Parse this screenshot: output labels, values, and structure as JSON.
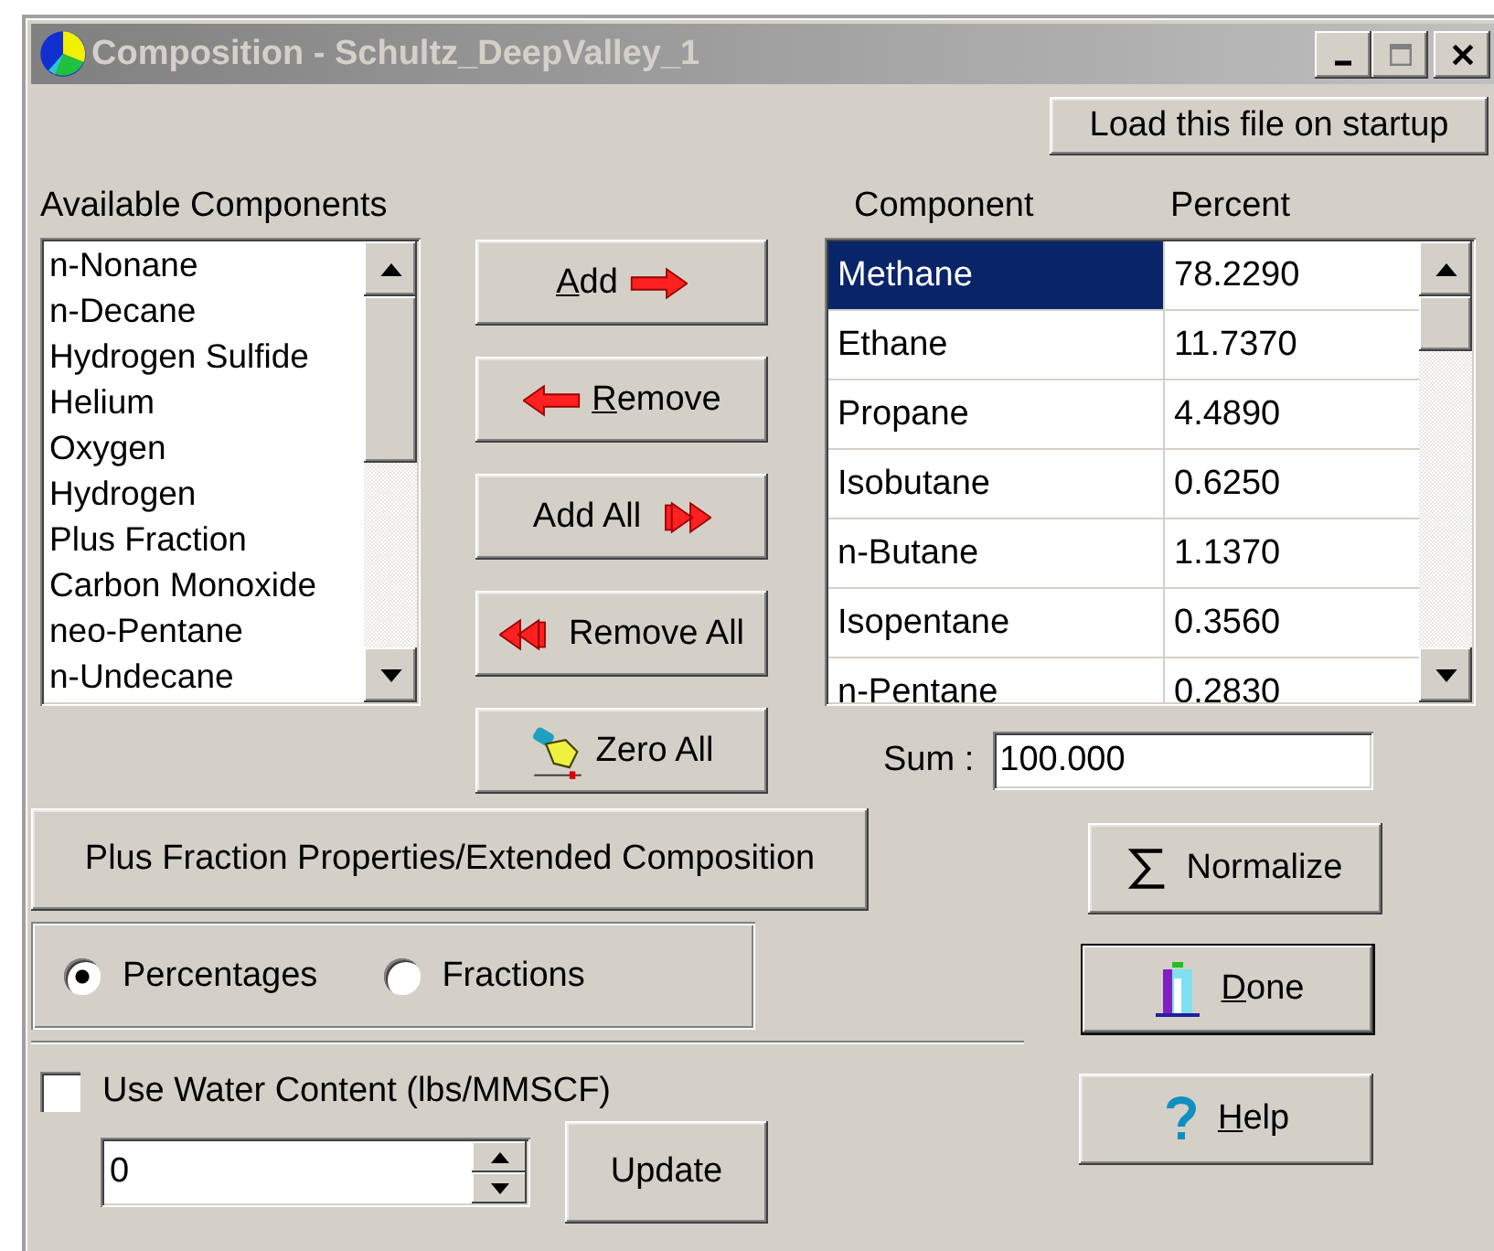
{
  "window": {
    "title": "Composition - Schultz_DeepValley_1"
  },
  "load_button": "Load this file on startup",
  "available": {
    "label": "Available Components",
    "items": [
      {
        "name": "n-Nonane",
        "selected": false
      },
      {
        "name": "n-Decane",
        "selected": false
      },
      {
        "name": "Hydrogen Sulfide",
        "selected": false
      },
      {
        "name": "Helium",
        "selected": false
      },
      {
        "name": "Oxygen",
        "selected": false
      },
      {
        "name": "Hydrogen",
        "selected": false
      },
      {
        "name": "Plus Fraction",
        "selected": false
      },
      {
        "name": "Carbon Monoxide",
        "selected": false
      },
      {
        "name": "neo-Pentane",
        "selected": false
      },
      {
        "name": "n-Undecane",
        "selected": false
      }
    ]
  },
  "transfer_buttons": [
    {
      "kind": "add",
      "label": "Add",
      "underline_first": true
    },
    {
      "kind": "remove",
      "label": "Remove",
      "underline_first": true
    },
    {
      "kind": "add_all",
      "label": "Add All",
      "underline_first": false
    },
    {
      "kind": "remove_all",
      "label": "Remove All",
      "underline_first": false
    },
    {
      "kind": "zero_all",
      "label": "Zero All",
      "underline_first": false
    }
  ],
  "composition": {
    "columns": [
      "Component",
      "Percent"
    ],
    "rows": [
      {
        "component": "Methane",
        "percent": "78.2290",
        "selected": true
      },
      {
        "component": "Ethane",
        "percent": "11.7370",
        "selected": false
      },
      {
        "component": "Propane",
        "percent": "4.4890",
        "selected": false
      },
      {
        "component": "Isobutane",
        "percent": "0.6250",
        "selected": false
      },
      {
        "component": "n-Butane",
        "percent": "1.1370",
        "selected": false
      },
      {
        "component": "Isopentane",
        "percent": "0.3560",
        "selected": false
      },
      {
        "component": "n-Pentane",
        "percent": "0.2830",
        "selected": false
      }
    ]
  },
  "sum": {
    "label": "Sum :",
    "value": "100.000"
  },
  "plus_fraction_button": "Plus Fraction Properties/Extended Composition",
  "units": [
    {
      "label": "Percentages",
      "selected": true
    },
    {
      "label": "Fractions",
      "selected": false
    }
  ],
  "water": {
    "label": "Use Water Content (lbs/MMSCF)",
    "checked": false,
    "value": "0"
  },
  "update_button": "Update",
  "action_buttons": [
    {
      "kind": "normalize",
      "label": "Normalize",
      "underline_first": false,
      "default": false
    },
    {
      "kind": "done",
      "label": "Done",
      "underline_first": true,
      "default": true
    },
    {
      "kind": "help",
      "label": "Help",
      "underline_first": true,
      "default": false
    }
  ]
}
